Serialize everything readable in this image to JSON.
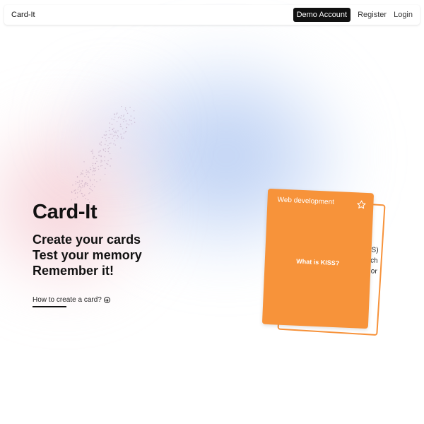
{
  "navbar": {
    "brand": "Card-It",
    "demo_label": "Demo Account",
    "register_label": "Register",
    "login_label": "Login"
  },
  "hero": {
    "title": "Card-It",
    "taglines": [
      "Create your cards",
      "Test your memory",
      "Remember it!"
    ],
    "howto_label": "How to create a card?",
    "howto_icon": "arrow-circle-right-icon"
  },
  "card": {
    "category": "Web development",
    "question": "What is KISS?",
    "back_text_lines": [
      "SS)",
      "ch",
      "or"
    ],
    "star_icon": "star-outline-icon"
  },
  "colors": {
    "accent": "#f7933a",
    "dark": "#111111",
    "bg_blue": "#c3d4f3",
    "bg_pink": "#f0c0c8"
  }
}
